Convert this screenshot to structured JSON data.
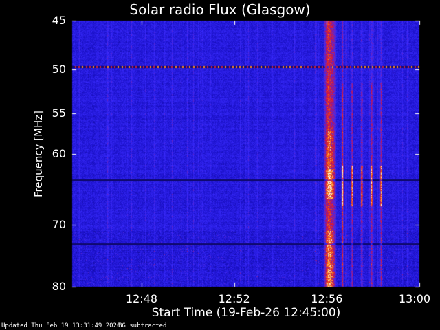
{
  "chart_data": {
    "type": "heatmap",
    "title": "Solar radio Flux (Glasgow)",
    "xlabel": "Start Time (19-Feb-26 12:45:00)",
    "ylabel": "Frequency [MHz]",
    "x_range": [
      "12:45:00",
      "13:00:00"
    ],
    "y_range": [
      45,
      80
    ],
    "x_ticks": [
      "12:48",
      "12:52",
      "12:56",
      "13:00"
    ],
    "y_ticks": [
      "45",
      "50",
      "55",
      "60",
      "70",
      "80"
    ],
    "y_tick_values": [
      45,
      50,
      55,
      60,
      70,
      80
    ],
    "y_scale": "log",
    "colormap": [
      "#000000",
      "#1a10c8",
      "#3a2cff",
      "#d01040",
      "#ff7000",
      "#ffe090",
      "#ffffff"
    ],
    "features": [
      {
        "kind": "interference_line",
        "frequency_mhz": 49.7
      },
      {
        "kind": "interference_line",
        "frequency_mhz": 63.5
      },
      {
        "kind": "interference_line",
        "frequency_mhz": 73.0
      },
      {
        "kind": "burst_band",
        "time_start": "12:55:55",
        "time_end": "12:56:20"
      },
      {
        "kind": "burst_lines",
        "times": [
          "12:56:40",
          "12:57:05",
          "12:57:30",
          "12:57:55",
          "12:58:20"
        ]
      }
    ]
  },
  "footer": {
    "updated": "Updated Thu Feb 19 13:31:49 2026",
    "note": "BG subtracted"
  }
}
